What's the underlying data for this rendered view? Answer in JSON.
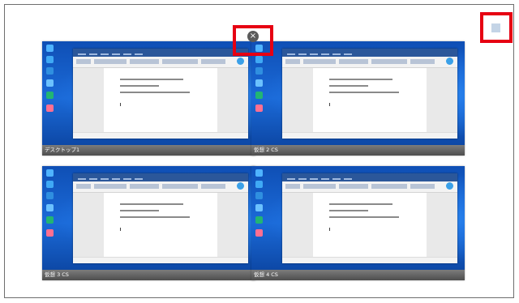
{
  "tiles": [
    {
      "caption": "デスクトップ1",
      "doc_lines": [
        "テキストテキストテキストテキスト。",
        "テキストテキスト。",
        "テキストテキストテキストテキストテキスト。"
      ]
    },
    {
      "caption": "仮想 2 CS",
      "doc_lines": [
        "テキストテキストテキストテキスト。",
        "テキストテキスト。",
        "テキストテキストテキストテキストテキスト。"
      ]
    },
    {
      "caption": "仮想 3 CS",
      "doc_lines": [
        "テキストテキストテキストテキスト。",
        "テキストテキスト。",
        "テキストテキストテキストテキストテキスト。"
      ]
    },
    {
      "caption": "仮想 4 CS",
      "doc_lines": [
        "テキストテキストテキストテキスト。",
        "テキストテキスト。",
        "テキストテキストテキストテキストテキスト。"
      ]
    }
  ],
  "close_button": {
    "glyph": "×",
    "icon": "close-icon"
  },
  "highlight_color": "#e60012",
  "desktop_icon_colors": [
    "#4fb3ff",
    "#3fa9f5",
    "#2f8fe0",
    "#6bc1ff",
    "#22b573",
    "#ff6f91"
  ]
}
